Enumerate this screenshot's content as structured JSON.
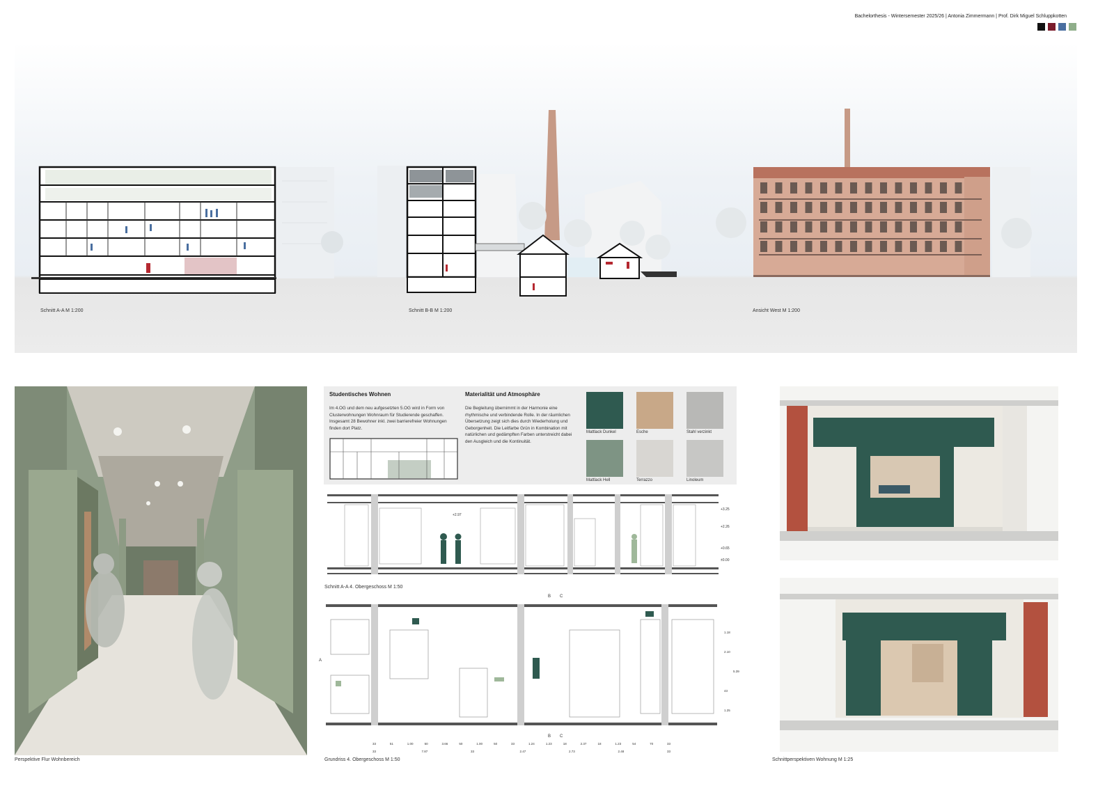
{
  "header": {
    "credit": "Bachelorthesis - Wintersemester 2025/26 | Antonia Zimmermann | Prof. Dirk Miguel Schluppkotten",
    "palette": [
      "#111111",
      "#7b1c2c",
      "#4a6fa0",
      "#8fae8a"
    ]
  },
  "top": {
    "section_aa": "Schnitt A-A M 1:200",
    "section_bb": "Schnitt B-B M 1:200",
    "elevation_west": "Ansicht West M 1:200"
  },
  "text_panel": {
    "heading_1": "Studentisches Wohnen",
    "body_1": "Im 4.OG und dem neu aufgesetzten 5.OG wird in Form von Clusterwohnungen Wohnraum für Studierende geschaffen. Insgesamt 28 Bewohner inkl. zwei barrierefreier Wohnungen finden dort Platz.",
    "heading_2": "Materialität und Atmosphäre",
    "body_2": "Die Begleitung übernimmt in der Harmonie eine rhythmische und verbindende Rolle. In der räumlichen Übersetzung zeigt sich dies durch Wiederholung und Geborgenheit. Die Leitfarbe Grün in Kombination mit natürlichen und gedämpften Farben unterstreicht dabei den Ausgleich und die Kontinuität."
  },
  "materials": [
    {
      "label": "Mattlack Dunkel",
      "color": "#2f5a50"
    },
    {
      "label": "Esche",
      "color": "#c8a888"
    },
    {
      "label": "Stahl verzinkt",
      "color": "#b8b8b6"
    },
    {
      "label": "Mattlack Hell",
      "color": "#7e9484"
    },
    {
      "label": "Terrazzo",
      "color": "#d8d6d2"
    },
    {
      "label": "Linoleum",
      "color": "#c7c7c5"
    }
  ],
  "section_4og": {
    "caption": "Schnitt A-A 4. Obergeschoss M 1:50",
    "level_mark": "+2.97",
    "levels": [
      "+3.25",
      "+2.26",
      "+0.65",
      "±0.00"
    ]
  },
  "plan_4og": {
    "caption": "Grundriss 4. Obergeschoss M 1:50",
    "axis_labels": [
      "B",
      "C",
      "A"
    ],
    "dims_row1": [
      "33",
      "51",
      "1.00",
      "50",
      "3.66",
      "50",
      "1.00",
      "50",
      "33",
      "1.24",
      "1.23",
      "18",
      "2.37",
      "18",
      "1.23",
      "54",
      "70",
      "33"
    ],
    "dims_row2": [
      "33",
      "7.87",
      "33",
      "2.47",
      "2.73",
      "2.48",
      "33"
    ],
    "dims_side": [
      "1.18",
      "2.10",
      "5.39",
      "43",
      "1.25"
    ]
  },
  "render": {
    "caption": "Perspektive Flur Wohnbereich"
  },
  "right": {
    "caption": "Schnittperspektiven Wohnung M 1:25"
  }
}
